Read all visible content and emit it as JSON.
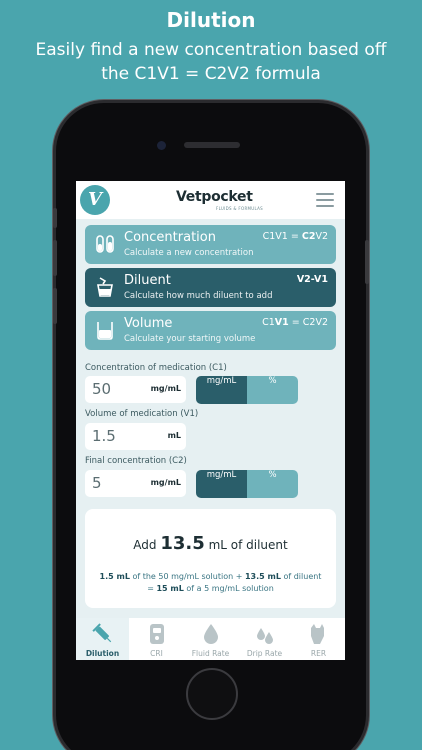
{
  "promo": {
    "title": "Dilution",
    "subtitle": "Easily find a new concentration based off the C1V1 = C2V2 formula"
  },
  "header": {
    "logo_letter": "V",
    "brand": "Vetpocket",
    "brand_tagline": "FLUIDS & FORMULAS",
    "menu_icon": "hamburger-menu-icon"
  },
  "modes": [
    {
      "title": "Concentration",
      "description": "Calculate a new concentration",
      "formula_pre": "C1V1 = ",
      "formula_bold": "C2",
      "formula_post": "V2",
      "icon": "test-tubes-icon",
      "active": false
    },
    {
      "title": "Diluent",
      "description": "Calculate how much diluent to add",
      "formula_pre": "",
      "formula_bold": "V2-V1",
      "formula_post": "",
      "icon": "pour-cup-icon",
      "active": true
    },
    {
      "title": "Volume",
      "description": "Calculate your starting volume",
      "formula_pre": "C1",
      "formula_bold": "V1",
      "formula_post": " = C2V2",
      "icon": "beaker-icon",
      "active": false
    }
  ],
  "fields": {
    "c1": {
      "label": "Concentration of medication (C1)",
      "value": "50",
      "unit": "mg/mL"
    },
    "v1": {
      "label": "Volume of medication (V1)",
      "value": "1.5",
      "unit": "mL"
    },
    "c2": {
      "label": "Final concentration (C2)",
      "value": "5",
      "unit": "mg/mL"
    }
  },
  "unit_toggle": {
    "option_a": "mg/mL",
    "option_b": "%",
    "selected": "mg/mL"
  },
  "result": {
    "prefix": "Add",
    "amount": "13.5",
    "suffix": "mL of diluent",
    "line1_v1": "1.5 mL",
    "line1_mid": "of the 50 mg/mL solution +",
    "line1_diluent": "13.5 mL",
    "line1_end": "of diluent",
    "line2_eq": "=",
    "line2_total": "15 mL",
    "line2_end": "of a 5 mg/mL solution"
  },
  "tabs": [
    {
      "label": "Dilution",
      "icon": "syringe-icon",
      "active": true
    },
    {
      "label": "CRI",
      "icon": "iv-pump-icon",
      "active": false
    },
    {
      "label": "Fluid Rate",
      "icon": "drop-icon",
      "active": false
    },
    {
      "label": "Drip Rate",
      "icon": "drops-icon",
      "active": false
    },
    {
      "label": "RER",
      "icon": "dog-cat-icon",
      "active": false
    }
  ],
  "colors": {
    "background": "#4aa5ad",
    "accent_dark": "#2a5e6a",
    "accent_light": "#6fb3bb",
    "screen_bg": "#e6f0f2"
  }
}
